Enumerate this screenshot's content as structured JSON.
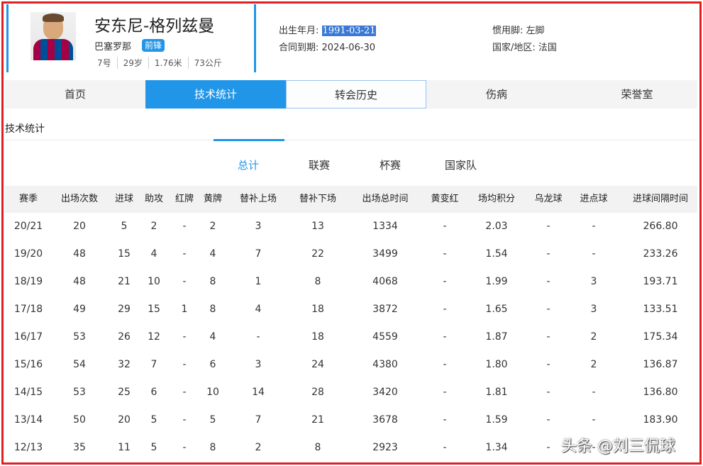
{
  "player": {
    "name": "安东尼-格列兹曼",
    "club": "巴塞罗那",
    "position": "前锋",
    "attrs": [
      "7号",
      "29岁",
      "1.76米",
      "73公斤"
    ]
  },
  "info": {
    "birth_label": "出生年月:",
    "birth_value": "1991-03-21",
    "contract_label": "合同到期:",
    "contract_value": "2024-06-30",
    "foot_label": "惯用脚:",
    "foot_value": "左脚",
    "country_label": "国家/地区:",
    "country_value": "法国"
  },
  "nav": {
    "tabs": [
      "首页",
      "技术统计",
      "转会历史",
      "伤病",
      "荣誉室"
    ]
  },
  "section_title": "技术统计",
  "subtabs": [
    "总计",
    "联赛",
    "杯赛",
    "国家队"
  ],
  "table": {
    "headers": [
      "赛季",
      "出场次数",
      "进球",
      "助攻",
      "红牌",
      "黄牌",
      "替补上场",
      "替补下场",
      "出场总时间",
      "黄变红",
      "场均积分",
      "乌龙球",
      "进点球",
      "进球间隔时间"
    ],
    "rows": [
      [
        "20/21",
        "20",
        "5",
        "2",
        "-",
        "2",
        "3",
        "13",
        "1334",
        "-",
        "2.03",
        "-",
        "-",
        "266.80"
      ],
      [
        "19/20",
        "48",
        "15",
        "4",
        "-",
        "4",
        "7",
        "22",
        "3499",
        "-",
        "1.54",
        "-",
        "-",
        "233.26"
      ],
      [
        "18/19",
        "48",
        "21",
        "10",
        "-",
        "8",
        "1",
        "8",
        "4068",
        "-",
        "1.99",
        "-",
        "3",
        "193.71"
      ],
      [
        "17/18",
        "49",
        "29",
        "15",
        "1",
        "8",
        "4",
        "18",
        "3872",
        "-",
        "1.65",
        "-",
        "3",
        "133.51"
      ],
      [
        "16/17",
        "53",
        "26",
        "12",
        "-",
        "4",
        "-",
        "18",
        "4559",
        "-",
        "1.87",
        "-",
        "2",
        "175.34"
      ],
      [
        "15/16",
        "54",
        "32",
        "7",
        "-",
        "6",
        "3",
        "24",
        "4380",
        "-",
        "1.80",
        "-",
        "2",
        "136.87"
      ],
      [
        "14/15",
        "53",
        "25",
        "6",
        "-",
        "10",
        "14",
        "28",
        "3420",
        "-",
        "1.81",
        "-",
        "-",
        "136.80"
      ],
      [
        "13/14",
        "50",
        "20",
        "5",
        "-",
        "5",
        "7",
        "21",
        "3678",
        "-",
        "1.59",
        "-",
        "-",
        "183.90"
      ],
      [
        "12/13",
        "35",
        "11",
        "5",
        "-",
        "8",
        "2",
        "8",
        "2923",
        "-",
        "1.34",
        "-",
        "-",
        ""
      ]
    ]
  },
  "watermark": "头条 @刘三侃球",
  "colors": {
    "accent": "#2196e8",
    "frame": "#e02020",
    "highlight": "#3b79d6"
  }
}
